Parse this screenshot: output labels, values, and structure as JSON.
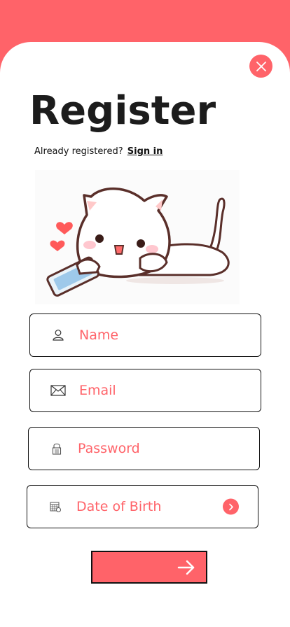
{
  "header": {
    "title": "Register"
  },
  "signin_prompt": {
    "text": "Already registered?",
    "link": "Sign in"
  },
  "fields": {
    "name": {
      "label": "Name",
      "icon": "user-icon"
    },
    "email": {
      "label": "Email",
      "icon": "envelope-icon"
    },
    "password": {
      "label": "Password",
      "icon": "lock-icon"
    },
    "dob": {
      "label": "Date of Birth",
      "icon": "calendar-icon",
      "action_icon": "chevron-right-icon"
    }
  },
  "actions": {
    "close_icon": "close-icon",
    "submit_icon": "arrow-right-icon"
  },
  "colors": {
    "accent": "#ff6369",
    "text": "#1c1c1c",
    "border": "#111111",
    "background": "#ffffff"
  }
}
